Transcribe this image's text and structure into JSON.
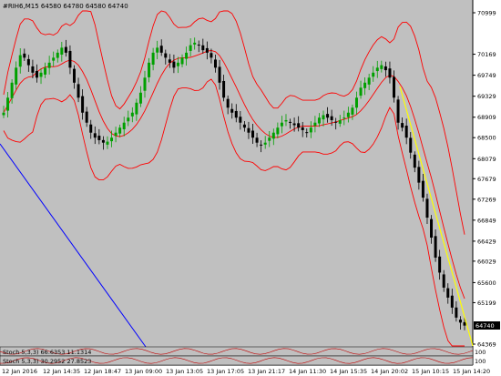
{
  "header": {
    "title": "#RIH6,M15  64580 64780 64580 64740"
  },
  "price_axis": {
    "labels": [
      "70999",
      "70169",
      "69749",
      "69329",
      "68909",
      "68500",
      "68079",
      "67679",
      "67269",
      "66849",
      "66429",
      "66029",
      "65600",
      "65199",
      "64369"
    ],
    "current_price": "64740"
  },
  "time_axis": {
    "labels": [
      "12 Jan 2016",
      "12 Jan 14:35",
      "12 Jan 18:47",
      "13 Jan 09:00",
      "13 Jan 13:05",
      "13 Jan 17:05",
      "13 Jan 21:17",
      "14 Jan 11:30",
      "14 Jan 15:35",
      "14 Jan 20:02",
      "15 Jan 10:15",
      "15 Jan 14:20"
    ]
  },
  "subwindows": {
    "top": {
      "label": "Stoch 5,3,3) 66.6353 11.1314",
      "right_label": "100"
    },
    "bottom": {
      "label": "Stoch 5,3,3) 30.2952 27.8523",
      "right_label": "100"
    }
  },
  "colors": {
    "background": "#c0c0c0",
    "up_candle": "#00a000",
    "down_candle": "#000000",
    "bands": "#ff0000",
    "trendline_yellow": "#ffff00",
    "trendline_blue": "#0000ff",
    "axis_bg": "#ffffff"
  },
  "chart_data": {
    "type": "candlestick",
    "symbol": "#RIH6",
    "timeframe": "M15",
    "y_range": [
      64369,
      70999
    ],
    "closes_approx": [
      69000,
      69300,
      69600,
      69900,
      70150,
      70100,
      69950,
      69800,
      69700,
      69800,
      69900,
      70000,
      70100,
      70200,
      70300,
      70200,
      69900,
      69600,
      69300,
      69000,
      68800,
      68600,
      68500,
      68450,
      68400,
      68420,
      68500,
      68600,
      68700,
      68800,
      68900,
      69000,
      69200,
      69400,
      69700,
      70000,
      70200,
      70300,
      70200,
      70100,
      70000,
      69900,
      70000,
      70100,
      70200,
      70350,
      70400,
      70350,
      70250,
      70200,
      70100,
      69900,
      69600,
      69300,
      69100,
      69000,
      68900,
      68800,
      68700,
      68600,
      68500,
      68400,
      68350,
      68400,
      68500,
      68600,
      68700,
      68800,
      68850,
      68800,
      68750,
      68700,
      68650,
      68600,
      68700,
      68800,
      68900,
      68950,
      68900,
      68850,
      68800,
      68850,
      68900,
      69000,
      69100,
      69300,
      69500,
      69600,
      69700,
      69800,
      69900,
      69950,
      69850,
      69700,
      69300,
      68800,
      68700,
      68500,
      68200,
      67900,
      67600,
      67300,
      66900,
      66500,
      66100,
      65800,
      65500,
      65300,
      65100,
      64900,
      64800,
      64740
    ]
  }
}
